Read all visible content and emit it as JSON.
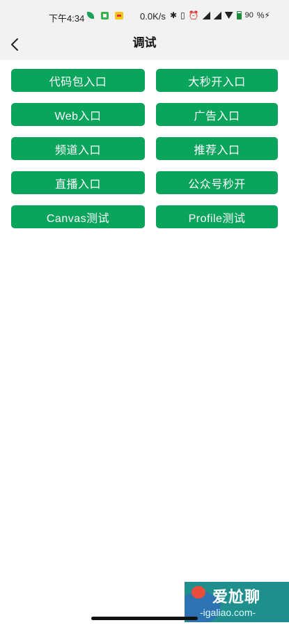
{
  "status_bar": {
    "time": "下午4:34",
    "net_speed": "0.0K/s",
    "battery_level": "90"
  },
  "header": {
    "title": "调试"
  },
  "entries": [
    "代码包入口",
    "大秒开入口",
    "Web入口",
    "广告入口",
    "频道入口",
    "推荐入口",
    "直播入口",
    "公众号秒开",
    "Canvas测试",
    "Profile测试"
  ],
  "watermark": {
    "text": "爱尬聊",
    "url": "-igaliao.com-"
  },
  "colors": {
    "button_green": "#0aa45d",
    "header_bg": "#f2f2f2"
  }
}
